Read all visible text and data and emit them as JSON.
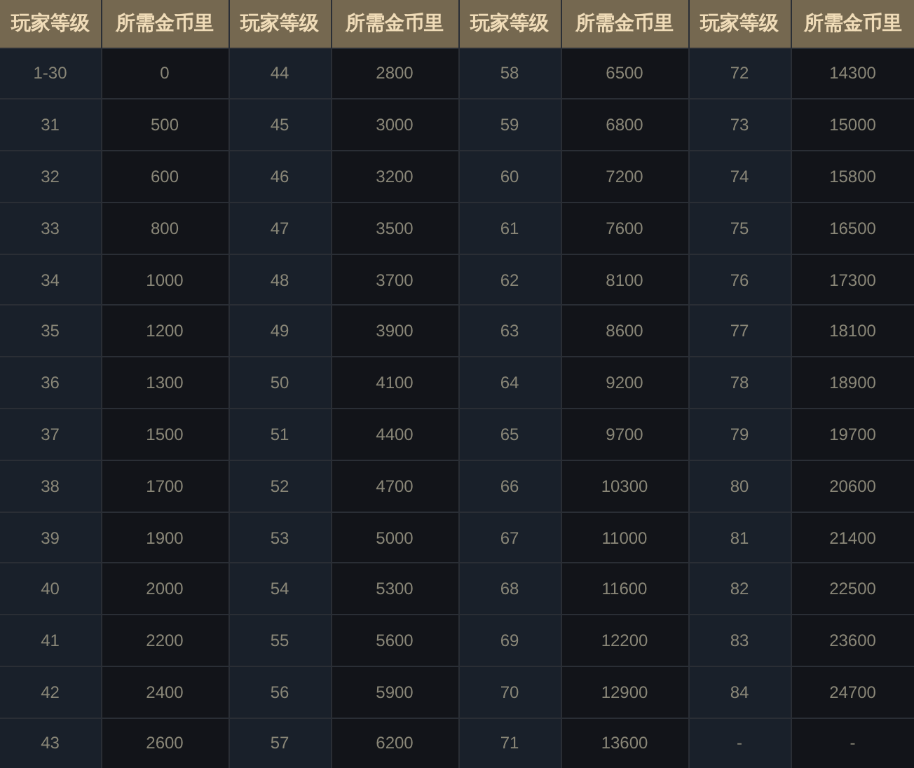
{
  "table": {
    "columns": [
      "玩家等级",
      "所需金币里",
      "玩家等级",
      "所需金币里",
      "玩家等级",
      "所需金币里",
      "玩家等级",
      "所需金币里"
    ],
    "rows": [
      [
        "1-30",
        "0",
        "44",
        "2800",
        "58",
        "6500",
        "72",
        "14300"
      ],
      [
        "31",
        "500",
        "45",
        "3000",
        "59",
        "6800",
        "73",
        "15000"
      ],
      [
        "32",
        "600",
        "46",
        "3200",
        "60",
        "7200",
        "74",
        "15800"
      ],
      [
        "33",
        "800",
        "47",
        "3500",
        "61",
        "7600",
        "75",
        "16500"
      ],
      [
        "34",
        "1000",
        "48",
        "3700",
        "62",
        "8100",
        "76",
        "17300"
      ],
      [
        "35",
        "1200",
        "49",
        "3900",
        "63",
        "8600",
        "77",
        "18100"
      ],
      [
        "36",
        "1300",
        "50",
        "4100",
        "64",
        "9200",
        "78",
        "18900"
      ],
      [
        "37",
        "1500",
        "51",
        "4400",
        "65",
        "9700",
        "79",
        "19700"
      ],
      [
        "38",
        "1700",
        "52",
        "4700",
        "66",
        "10300",
        "80",
        "20600"
      ],
      [
        "39",
        "1900",
        "53",
        "5000",
        "67",
        "11000",
        "81",
        "21400"
      ],
      [
        "40",
        "2000",
        "54",
        "5300",
        "68",
        "11600",
        "82",
        "22500"
      ],
      [
        "41",
        "2200",
        "55",
        "5600",
        "69",
        "12200",
        "83",
        "23600"
      ],
      [
        "42",
        "2400",
        "56",
        "5900",
        "70",
        "12900",
        "84",
        "24700"
      ],
      [
        "43",
        "2600",
        "57",
        "6200",
        "71",
        "13600",
        "-",
        "-"
      ]
    ]
  }
}
